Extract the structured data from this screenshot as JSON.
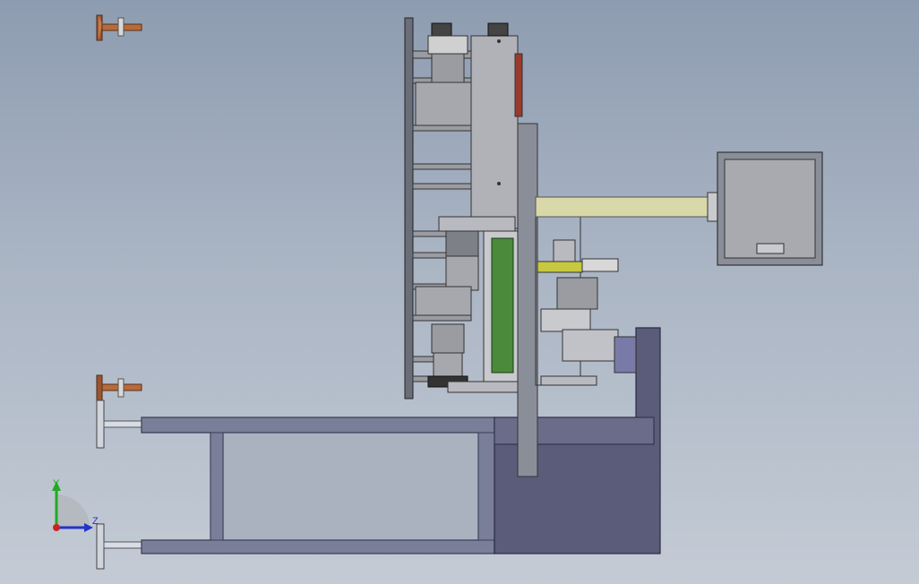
{
  "viewport": {
    "background_top": "#8e9cb1",
    "background_bottom": "#c4cbd5"
  },
  "triad": {
    "y_label": "Y",
    "z_label": "Z",
    "y_color": "#22aa22",
    "z_color": "#2233cc",
    "origin_color": "#cc2222"
  },
  "colors": {
    "frame_fill": "#7a7f99",
    "frame_stroke": "#3a3d55",
    "base_fill": "#5a5c7a",
    "plate_fill": "#8a8e98",
    "panel_fill": "#b0b2b8",
    "motor_fill": "#9a9ca2",
    "green_roller": "#4a8a3a",
    "shaft": "#d8d8a8",
    "copper": "#b86a3a",
    "box_fill": "#a8aab0"
  }
}
